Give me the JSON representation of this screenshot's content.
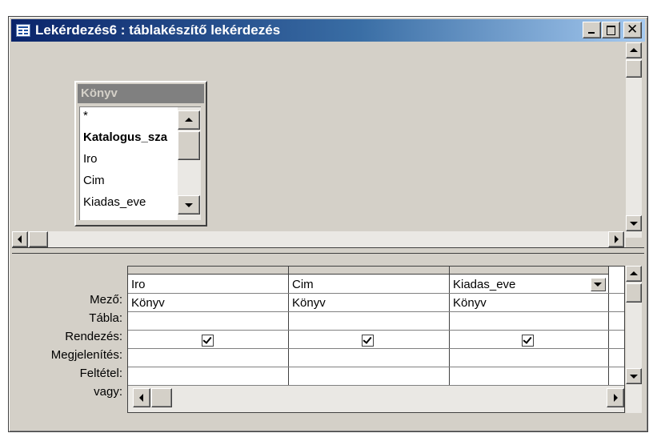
{
  "window": {
    "title": "Lekérdezés6 : táblakészítő lekérdezés"
  },
  "table_box": {
    "title": "Könyv",
    "fields": [
      {
        "label": "*",
        "bold": false
      },
      {
        "label": "Katalogus_sza",
        "bold": true
      },
      {
        "label": "Iro",
        "bold": false
      },
      {
        "label": "Cim",
        "bold": false
      },
      {
        "label": "Kiadas_eve",
        "bold": false
      }
    ]
  },
  "grid": {
    "row_labels": [
      "Mező:",
      "Tábla:",
      "Rendezés:",
      "Megjelenítés:",
      "Feltétel:",
      "vagy:"
    ],
    "columns": [
      {
        "field": "Iro",
        "table": "Könyv",
        "show": true
      },
      {
        "field": "Cim",
        "table": "Könyv",
        "show": true
      },
      {
        "field": "Kiadas_eve",
        "table": "Könyv",
        "show": true,
        "dropdown": true
      }
    ]
  },
  "icons": {
    "app": "query-icon",
    "minimize": "minimize-icon",
    "maximize": "maximize-icon",
    "close": "close-icon"
  }
}
